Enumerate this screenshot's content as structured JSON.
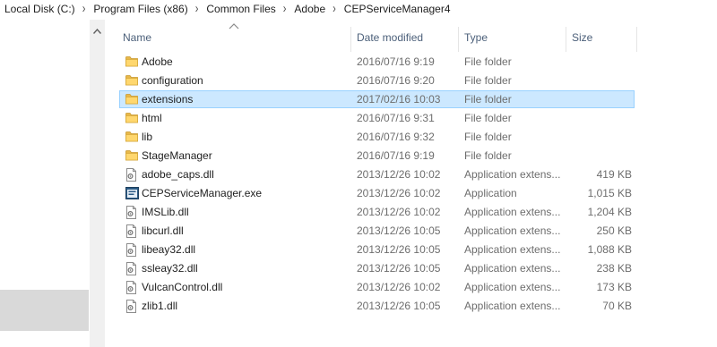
{
  "breadcrumb": {
    "items": [
      "Local Disk (C:)",
      "Program Files (x86)",
      "Common Files",
      "Adobe",
      "CEPServiceManager4"
    ],
    "separator": "›"
  },
  "columns": {
    "name": "Name",
    "date_modified": "Date modified",
    "type": "Type",
    "size": "Size"
  },
  "files": [
    {
      "name": "Adobe",
      "date": "2016/07/16 9:19",
      "type": "File folder",
      "size": "",
      "icon": "folder-icon"
    },
    {
      "name": "configuration",
      "date": "2016/07/16 9:20",
      "type": "File folder",
      "size": "",
      "icon": "folder-icon"
    },
    {
      "name": "extensions",
      "date": "2017/02/16 10:03",
      "type": "File folder",
      "size": "",
      "icon": "folder-icon",
      "selected": true
    },
    {
      "name": "html",
      "date": "2016/07/16 9:31",
      "type": "File folder",
      "size": "",
      "icon": "folder-icon"
    },
    {
      "name": "lib",
      "date": "2016/07/16 9:32",
      "type": "File folder",
      "size": "",
      "icon": "folder-icon"
    },
    {
      "name": "StageManager",
      "date": "2016/07/16 9:19",
      "type": "File folder",
      "size": "",
      "icon": "folder-icon"
    },
    {
      "name": "adobe_caps.dll",
      "date": "2013/12/26 10:02",
      "type": "Application extens...",
      "size": "419 KB",
      "icon": "dll-file-icon"
    },
    {
      "name": "CEPServiceManager.exe",
      "date": "2013/12/26 10:02",
      "type": "Application",
      "size": "1,015 KB",
      "icon": "exe-file-icon"
    },
    {
      "name": "IMSLib.dll",
      "date": "2013/12/26 10:02",
      "type": "Application extens...",
      "size": "1,204 KB",
      "icon": "dll-file-icon"
    },
    {
      "name": "libcurl.dll",
      "date": "2013/12/26 10:05",
      "type": "Application extens...",
      "size": "250 KB",
      "icon": "dll-file-icon"
    },
    {
      "name": "libeay32.dll",
      "date": "2013/12/26 10:05",
      "type": "Application extens...",
      "size": "1,088 KB",
      "icon": "dll-file-icon"
    },
    {
      "name": "ssleay32.dll",
      "date": "2013/12/26 10:05",
      "type": "Application extens...",
      "size": "238 KB",
      "icon": "dll-file-icon"
    },
    {
      "name": "VulcanControl.dll",
      "date": "2013/12/26 10:02",
      "type": "Application extens...",
      "size": "173 KB",
      "icon": "dll-file-icon"
    },
    {
      "name": "zlib1.dll",
      "date": "2013/12/26 10:05",
      "type": "Application extens...",
      "size": "70 KB",
      "icon": "dll-file-icon"
    }
  ],
  "colors": {
    "selection_fill": "#cce8ff",
    "selection_border": "#99d1ff",
    "header_text": "#4c607a",
    "folder_yellow": "#ffd76e"
  }
}
